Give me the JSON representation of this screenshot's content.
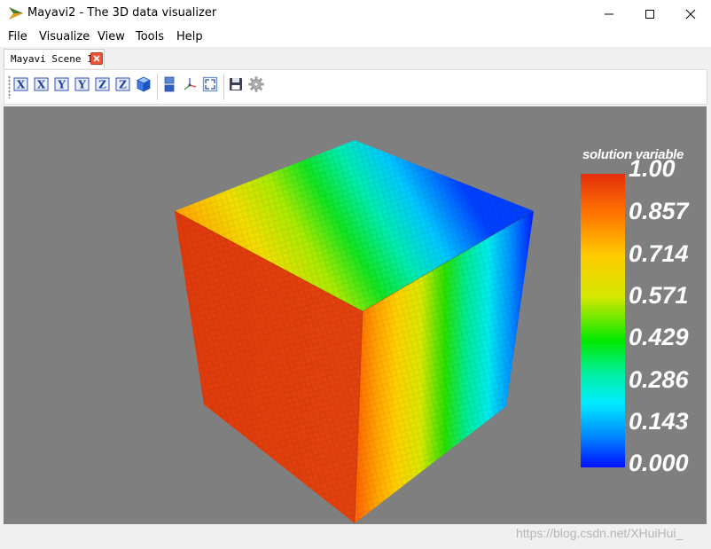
{
  "window": {
    "title": "Mayavi2 - The 3D data visualizer",
    "logo_icon": "mayavi-logo-icon",
    "controls": [
      "minimize-icon",
      "maximize-icon",
      "close-icon"
    ]
  },
  "menu": {
    "items": [
      "File",
      "Visualize",
      "View",
      "Tools",
      "Help"
    ]
  },
  "tabs": [
    {
      "label": "Mayavi Scene 1",
      "close_icon": "close-tab-icon"
    }
  ],
  "toolbar": {
    "buttons": [
      {
        "name": "view-x-plus-button",
        "label": "X",
        "icon": "axis-x-icon"
      },
      {
        "name": "view-x-minus-button",
        "label": "X",
        "icon": "axis-x-icon"
      },
      {
        "name": "view-y-plus-button",
        "label": "Y",
        "icon": "axis-y-icon"
      },
      {
        "name": "view-y-minus-button",
        "label": "Y",
        "icon": "axis-y-icon"
      },
      {
        "name": "view-z-plus-button",
        "label": "Z",
        "icon": "axis-z-icon"
      },
      {
        "name": "view-z-minus-button",
        "label": "Z",
        "icon": "axis-z-icon"
      },
      {
        "name": "isometric-view-button",
        "icon": "cube-icon"
      },
      {
        "name": "parallel-projection-button",
        "icon": "parallel-projection-icon"
      },
      {
        "name": "toggle-axes-button",
        "icon": "axes-indicator-icon"
      },
      {
        "name": "full-screen-button",
        "icon": "fullscreen-icon"
      },
      {
        "name": "save-scene-button",
        "icon": "save-icon"
      },
      {
        "name": "configure-scene-button",
        "icon": "gear-icon"
      }
    ]
  },
  "scene": {
    "background_color": "#7f7f7f",
    "colorbar": {
      "title": "solution variable",
      "ticks": [
        "1.00",
        "0.857",
        "0.714",
        "0.571",
        "0.429",
        "0.286",
        "0.143",
        "0.000"
      ],
      "colormap": [
        "#0010ff",
        "#008cff",
        "#00ecff",
        "#00f0a0",
        "#00e800",
        "#d4e800",
        "#ffcc00",
        "#ff7700",
        "#e62e0c"
      ]
    }
  },
  "watermark": "https://blog.csdn.net/XHuiHui_"
}
